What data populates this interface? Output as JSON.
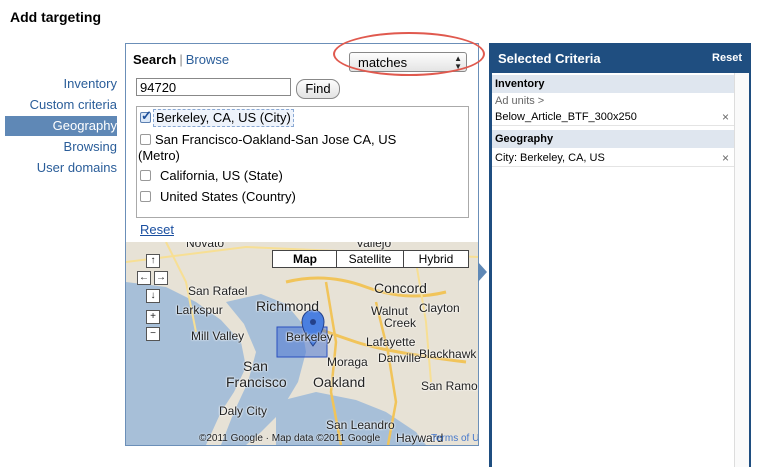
{
  "page": {
    "title": "Add targeting"
  },
  "nav": {
    "items": [
      {
        "label": "Inventory"
      },
      {
        "label": "Custom criteria"
      },
      {
        "label": "Geography",
        "active": true
      },
      {
        "label": "Browsing"
      },
      {
        "label": "User domains"
      }
    ]
  },
  "search": {
    "tab_search": "Search",
    "separator": "|",
    "tab_browse": "Browse",
    "match_mode": "matches",
    "query": "94720",
    "find_label": "Find",
    "results": [
      {
        "label": "Berkeley, CA, US (City)",
        "checked": true
      },
      {
        "label": "San Francisco-Oakland-San Jose CA, US",
        "label2": "(Metro)",
        "checked": false
      },
      {
        "label": "California, US (State)",
        "checked": false
      },
      {
        "label": "United States (Country)",
        "checked": false
      }
    ],
    "reset_label": "Reset"
  },
  "map": {
    "type_buttons": [
      "Map",
      "Satellite",
      "Hybrid"
    ],
    "active_type": "Map",
    "places": [
      "Novato",
      "Vallejo",
      "San Rafael",
      "Richmond",
      "Concord",
      "Larkspur",
      "Walnut",
      "Clayton",
      "Mill Valley",
      "Creek",
      "Berkeley",
      "Lafayette",
      "Blackhawk",
      "Danville",
      "Moraga",
      "San",
      "Francisco",
      "Oakland",
      "San Ramon",
      "Daly City",
      "San Leandro",
      "Hayward"
    ],
    "footer": "©2011 Google · Map data ©2011 Google",
    "terms": "Terms of Use"
  },
  "criteria": {
    "title": "Selected Criteria",
    "reset_label": "Reset",
    "sections": [
      {
        "heading": "Inventory",
        "sub": "Ad units >",
        "items": [
          "Below_Article_BTF_300x250"
        ]
      },
      {
        "heading": "Geography",
        "items": [
          "City: Berkeley, CA, US"
        ]
      }
    ],
    "remove_glyph": "×"
  },
  "colors": {
    "accent": "#1f4e80",
    "nav_active": "#5f88b6",
    "highlight": "#e0594e"
  }
}
